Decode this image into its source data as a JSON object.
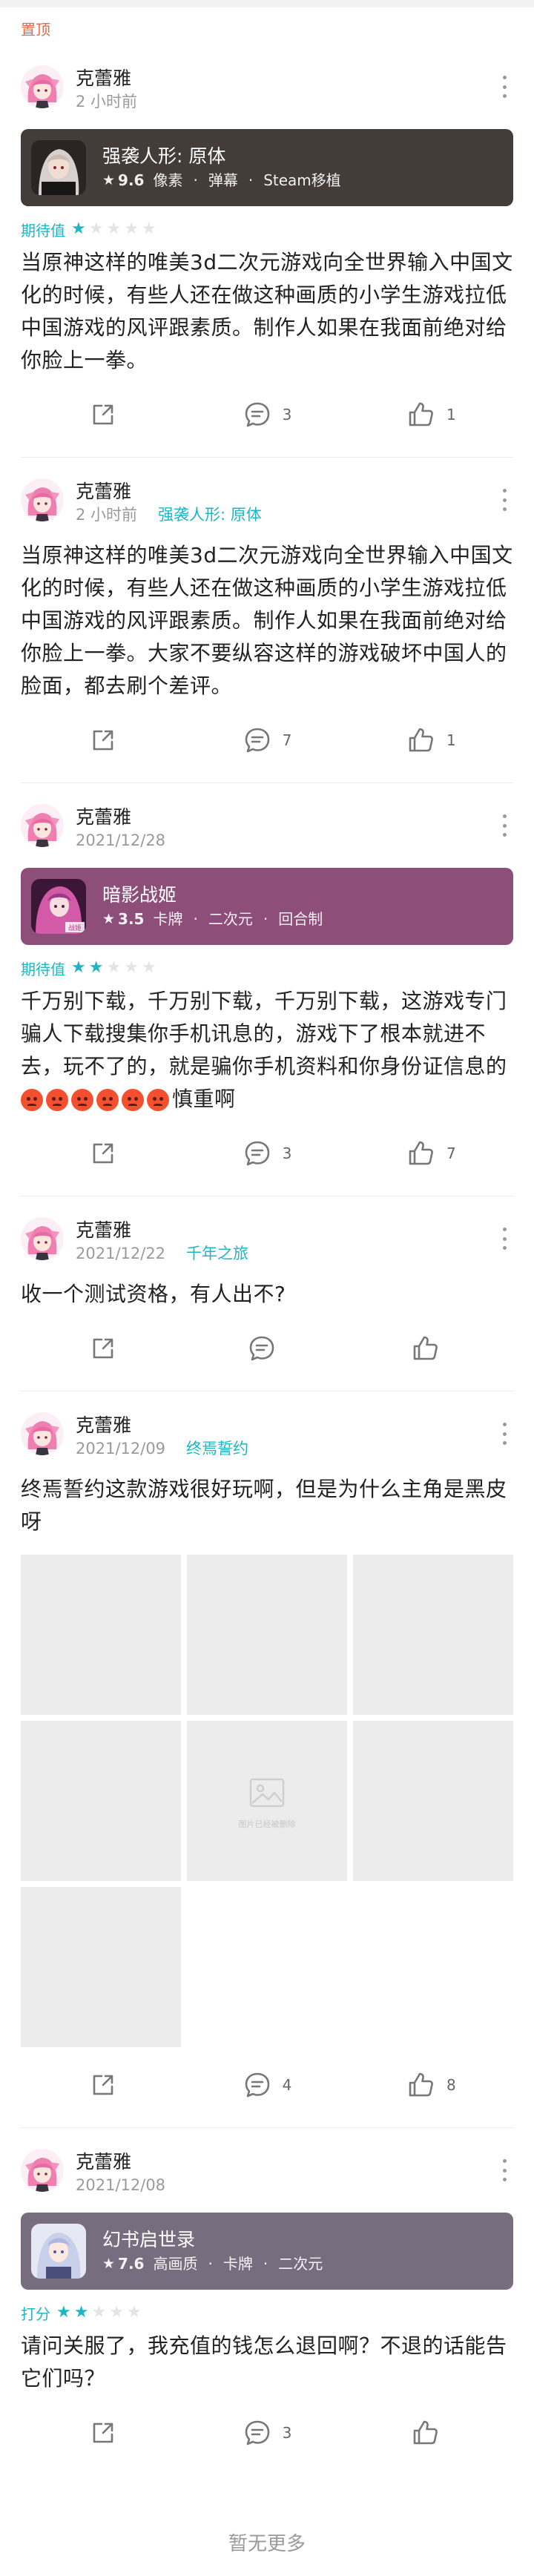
{
  "pinned_label": "置顶",
  "posts": [
    {
      "author": "克蕾雅",
      "time": "2 小时前",
      "game_link": "",
      "game": {
        "title": "强袭人形: 原体",
        "score": "9.6",
        "tags": [
          "像素",
          "弹幕",
          "Steam移植"
        ],
        "color": "#433c39"
      },
      "rating_label": "期待值",
      "stars": 1,
      "content": "当原神这样的唯美3d二次元游戏向全世界输入中国文化的时候，有些人还在做这种画质的小学生游戏拉低中国游戏的风评跟素质。制作人如果在我面前绝对给你脸上一拳。",
      "comments": "3",
      "likes": "1"
    },
    {
      "author": "克蕾雅",
      "time": "2 小时前",
      "game_link": "强袭人形: 原体",
      "content": "当原神这样的唯美3d二次元游戏向全世界输入中国文化的时候，有些人还在做这种画质的小学生游戏拉低中国游戏的风评跟素质。制作人如果在我面前绝对给你脸上一拳。大家不要纵容这样的游戏破坏中国人的脸面，都去刷个差评。",
      "comments": "7",
      "likes": "1"
    },
    {
      "author": "克蕾雅",
      "time": "2021/12/28",
      "game_link": "",
      "game": {
        "title": "暗影战姬",
        "score": "3.5",
        "tags": [
          "卡牌",
          "二次元",
          "回合制"
        ],
        "color": "#8d4f7a"
      },
      "rating_label": "期待值",
      "stars": 2,
      "content": "千万别下载，千万别下载，千万别下载，这游戏专门骗人下载搜集你手机讯息的，游戏下了根本就进不去，玩不了的，就是骗你手机资料和你身份证信息的",
      "content_tail": "慎重啊",
      "emoji_count": 6,
      "comments": "3",
      "likes": "7"
    },
    {
      "author": "克蕾雅",
      "time": "2021/12/22",
      "game_link": "千年之旅",
      "content": "收一个测试资格，有人出不?",
      "comments": "",
      "likes": ""
    },
    {
      "author": "克蕾雅",
      "time": "2021/12/09",
      "game_link": "终焉誓约",
      "content": "终焉誓约这款游戏很好玩啊，但是为什么主角是黑皮呀",
      "image_placeholder_text": "图片已经被删除",
      "image_count": 7,
      "comments": "4",
      "likes": "8"
    },
    {
      "author": "克蕾雅",
      "time": "2021/12/08",
      "game_link": "",
      "game": {
        "title": "幻书启世录",
        "score": "7.6",
        "tags": [
          "高画质",
          "卡牌",
          "二次元"
        ],
        "color": "#786d7e"
      },
      "rating_label": "打分",
      "stars": 2,
      "content": "请问关服了，我充值的钱怎么退回啊？不退的话能告它们吗？",
      "comments": "3",
      "likes": ""
    }
  ],
  "footer_text": "暂无更多",
  "colors": {
    "accent": "#1fb5c3",
    "pinned": "#e2694a",
    "muted": "#9a9a9a"
  },
  "icons": {
    "share": "share-icon",
    "comment": "comment-icon",
    "like": "thumbs-up-icon",
    "more": "more-vertical-icon"
  }
}
